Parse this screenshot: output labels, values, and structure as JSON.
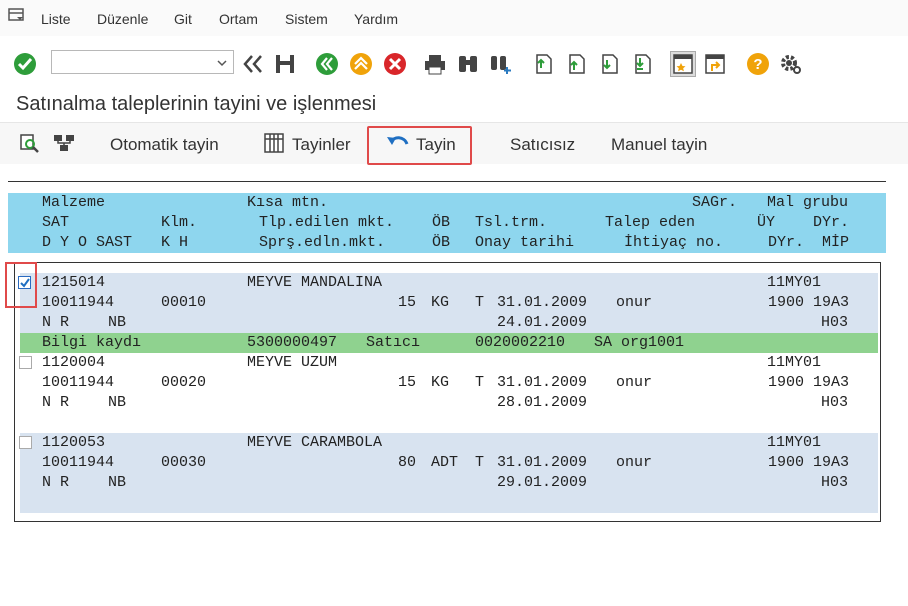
{
  "menu": {
    "items": [
      "Liste",
      "Düzenle",
      "Git",
      "Ortam",
      "Sistem",
      "Yardım"
    ]
  },
  "toolbar": {
    "command_field_value": "",
    "icons": [
      "enter-check-icon",
      "back-double-icon",
      "save-icon",
      "back-green-icon",
      "exit-up-icon",
      "cancel-icon",
      "print-icon",
      "find-icon",
      "find-next-icon",
      "first-page-icon",
      "previous-page-icon",
      "next-page-icon",
      "last-page-icon",
      "create-session-icon",
      "shortcut-icon",
      "help-icon",
      "settings-gear-icon"
    ]
  },
  "page": {
    "title": "Satınalma taleplerinin tayini ve işlenmesi"
  },
  "app_toolbar": {
    "otomatik": "Otomatik tayin",
    "tayinler": "Tayinler",
    "tayin": "Tayin",
    "saticisiz": "Satıcısız",
    "manuel": "Manuel tayin"
  },
  "header": {
    "rows": [
      [
        "Malzeme",
        "Kısa mtn.",
        "SAGr.",
        "Mal grubu"
      ],
      [
        "SAT",
        "Klm.",
        "Tlp.edilen mkt.",
        "ÖB",
        "Tsl.trm.",
        "Talep eden",
        "ÜY",
        "DYr."
      ],
      [
        "D Y O SAST",
        "K H",
        "Sprş.edln.mkt.",
        "ÖB",
        "Onay tarihi",
        "İhtiyaç no.",
        "DYr.",
        "MİP"
      ]
    ]
  },
  "items": [
    {
      "checked": true,
      "material": "1215014",
      "short_text": "MEYVE MANDALINA",
      "sagr_mg": "11MY01",
      "sat": "10011944",
      "klm": "00010",
      "qty": "15",
      "unit": "KG",
      "t": "T",
      "delivery": "31.01.2009",
      "requester": "onur",
      "uy_dyr": "1900 19A3",
      "dyo": "N R",
      "sast": "NB",
      "approval": "24.01.2009",
      "mip": "H03",
      "info": {
        "label": "Bilgi kaydı",
        "record": "5300000497",
        "vendor_label": "Satıcı",
        "vendor": "0020002210",
        "org": "SA org1001"
      }
    },
    {
      "checked": false,
      "material": "1120004",
      "short_text": "MEYVE UZUM",
      "sagr_mg": "11MY01",
      "sat": "10011944",
      "klm": "00020",
      "qty": "15",
      "unit": "KG",
      "t": "T",
      "delivery": "31.01.2009",
      "requester": "onur",
      "uy_dyr": "1900 19A3",
      "dyo": "N R",
      "sast": "NB",
      "approval": "28.01.2009",
      "mip": "H03"
    },
    {
      "checked": false,
      "material": "1120053",
      "short_text": "MEYVE CARAMBOLA",
      "sagr_mg": "11MY01",
      "sat": "10011944",
      "klm": "00030",
      "qty": "80",
      "unit": "ADT",
      "t": "T",
      "delivery": "31.01.2009",
      "requester": "onur",
      "uy_dyr": "1900 19A3",
      "dyo": "N R",
      "sast": "NB",
      "approval": "29.01.2009",
      "mip": "H03"
    }
  ]
}
